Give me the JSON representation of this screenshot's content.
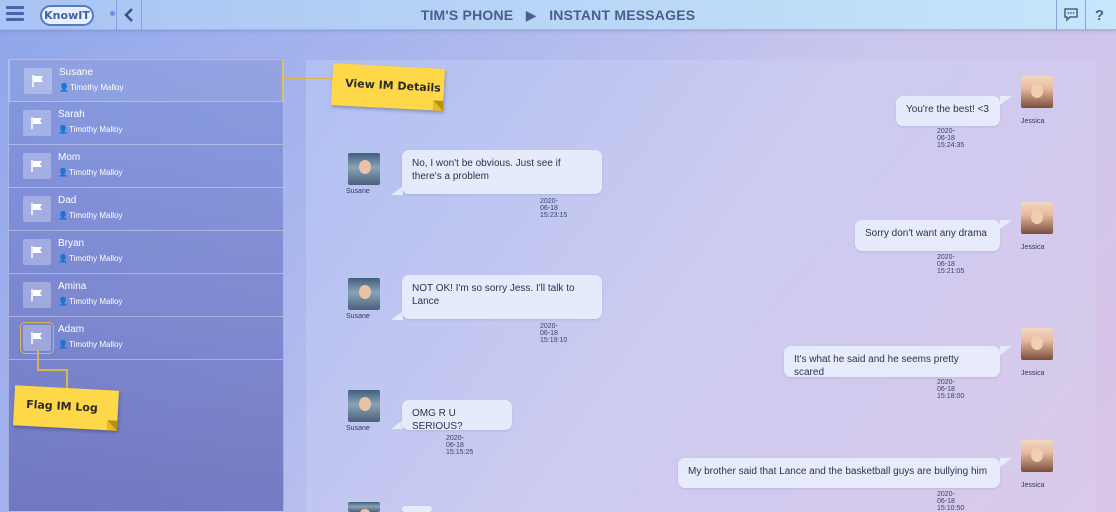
{
  "header": {
    "logo": "KnowIT",
    "breadcrumb_device": "TIM'S PHONE",
    "breadcrumb_page": "INSTANT MESSAGES",
    "back_icon": "chevron-left-icon",
    "chat_icon": "chat-bubble-icon",
    "help_label": "?"
  },
  "sidebar": {
    "items": [
      {
        "name": "Susane",
        "owner": "Timothy Malloy"
      },
      {
        "name": "Sarah",
        "owner": "Timothy Malloy"
      },
      {
        "name": "Mom",
        "owner": "Timothy Malloy"
      },
      {
        "name": "Dad",
        "owner": "Timothy Malloy"
      },
      {
        "name": "Bryan",
        "owner": "Timothy Malloy"
      },
      {
        "name": "Amina",
        "owner": "Timothy Malloy"
      },
      {
        "name": "Adam",
        "owner": "Timothy Malloy"
      }
    ]
  },
  "callouts": {
    "view_details": "View IM Details",
    "flag_log": "Flag IM Log"
  },
  "messages": [
    {
      "sender": "Jessica",
      "text": "You're the best! <3",
      "time": "2020-06-18 15:24:35",
      "side": "right"
    },
    {
      "sender": "Susane",
      "text": "No, I won't be obvious. Just see if there's a problem",
      "time": "2020-06-18 15:23:15",
      "side": "left"
    },
    {
      "sender": "Jessica",
      "text": "Sorry don't want any drama",
      "time": "2020-06-18 15:21:05",
      "side": "right"
    },
    {
      "sender": "Susane",
      "text": "NOT OK! I'm so sorry Jess. I'll talk to Lance",
      "time": "2020-06-18 15:19:10",
      "side": "left"
    },
    {
      "sender": "Jessica",
      "text": "It's what he said and he seems pretty scared",
      "time": "2020-06-18 15:18:00",
      "side": "right"
    },
    {
      "sender": "Susane",
      "text": "OMG R U SERIOUS?",
      "time": "2020-06-18 15:15:25",
      "side": "left"
    },
    {
      "sender": "Jessica",
      "text": "My brother said that Lance and the basketball guys are bullying him",
      "time": "2020-06-18 15:10:50",
      "side": "right"
    }
  ],
  "colors": {
    "callout": "#ffd84a",
    "topbar": "#b8d6f6",
    "bubble": "#e8eefc"
  }
}
